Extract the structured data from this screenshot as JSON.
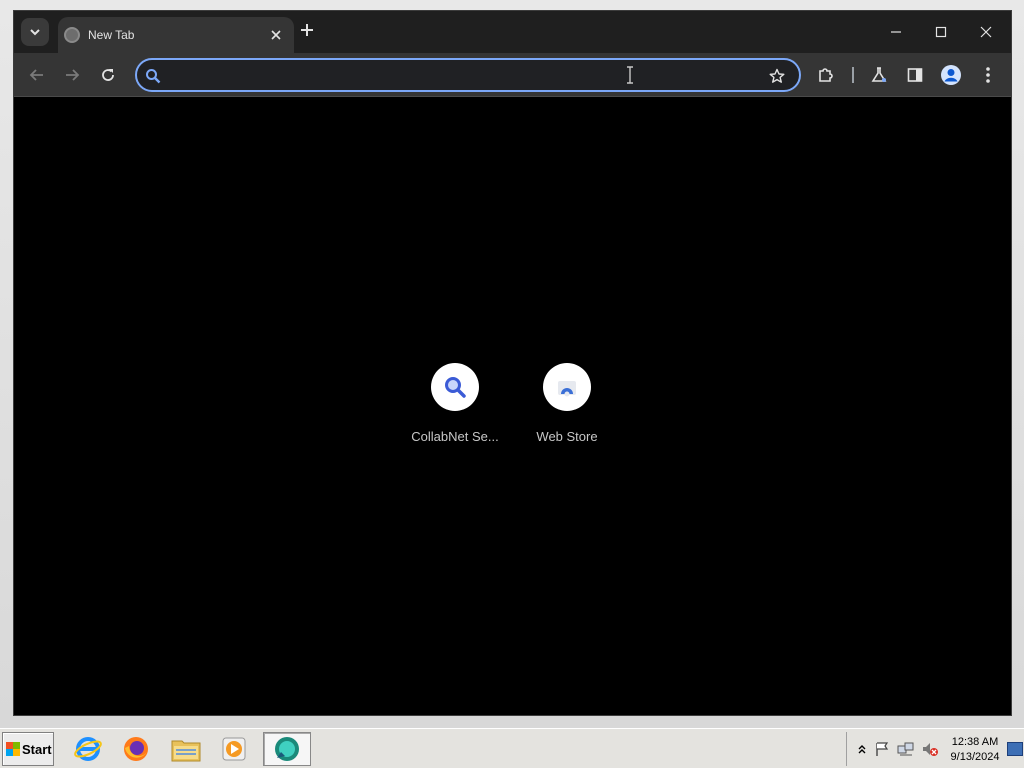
{
  "browser": {
    "tab": {
      "title": "New Tab",
      "close_icon": "close-icon"
    },
    "new_tab_icon": "plus-icon",
    "window_controls": [
      "minimize-icon",
      "maximize-icon",
      "close-icon"
    ],
    "omnibox": {
      "value": "",
      "placeholder": ""
    },
    "accent_color": "#7ca8f8"
  },
  "shortcuts": [
    {
      "label": "CollabNet Se...",
      "icon": "search-icon"
    },
    {
      "label": "Web Store",
      "icon": "web-store-icon"
    }
  ],
  "taskbar": {
    "start_label": "Start",
    "clock": {
      "time": "12:38 AM",
      "date": "9/13/2024"
    }
  }
}
